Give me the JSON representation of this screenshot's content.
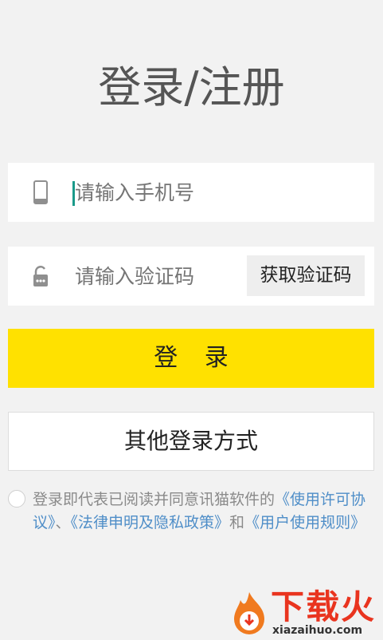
{
  "page": {
    "title": "登录/注册"
  },
  "phone_field": {
    "icon": "phone-icon",
    "placeholder": "请输入手机号"
  },
  "code_field": {
    "icon": "lock-icon",
    "placeholder": "请输入验证码",
    "get_code_label": "获取验证码"
  },
  "login_button": {
    "label": "登 录"
  },
  "other_login_button": {
    "label": "其他登录方式"
  },
  "agreement": {
    "prefix": "登录即代表已阅读并同意讯猫软件的",
    "license_link": "《使用许可协议》",
    "separator": "、",
    "privacy_link": "《法律申明及隐私政策》",
    "conjunction": "和",
    "rules_link": "《用户使用规则》"
  },
  "watermark": {
    "brand": "下载火",
    "url": "xiazaihuo.com"
  },
  "colors": {
    "accent_yellow": "#ffe100",
    "link_blue": "#4f8ec8",
    "caret_teal": "#1a9a8a",
    "watermark_red": "#e9341f"
  }
}
